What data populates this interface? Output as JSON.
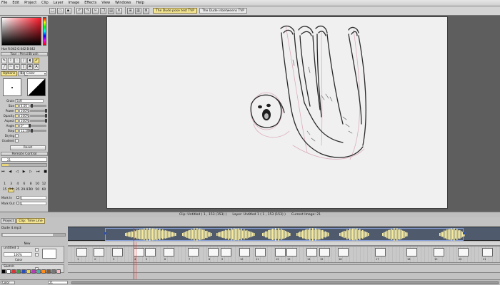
{
  "menu": [
    "File",
    "Edit",
    "Project",
    "Clip",
    "Layer",
    "Image",
    "Effects",
    "View",
    "Windows",
    "Help"
  ],
  "tabs": [
    {
      "label": "The Dude pose test TVP",
      "active": true
    },
    {
      "label": "The Dude inbetweens TVP",
      "active": false
    }
  ],
  "color_panel": {
    "readout": "Hue R:042 G:042 B:042"
  },
  "tool_panel": {
    "title": "Tool : PencilBrush",
    "mode": "Color",
    "subtabs": [
      "Options",
      "Bin"
    ],
    "params": [
      {
        "label": "Grain",
        "value": "Soft",
        "type": "dropdown"
      },
      {
        "label": "Size",
        "value": "4.00",
        "knob": 0.15
      },
      {
        "label": "Power",
        "value": "100%",
        "knob": 1.0
      },
      {
        "label": "Opacity",
        "value": "100%",
        "knob": 1.0
      },
      {
        "label": "Aspect",
        "value": "100%",
        "knob": 1.0
      },
      {
        "label": "Angle",
        "value": "0°",
        "knob": 0.0
      },
      {
        "label": "Step",
        "value": "12.50%",
        "knob": 0.12
      },
      {
        "label": "Drying",
        "value": "",
        "knob": null
      },
      {
        "label": "Gradient",
        "value": "",
        "knob": null
      }
    ],
    "reset_label": "Reset"
  },
  "remote_control": {
    "title": "Remote Control",
    "frame": "21",
    "progress": 0.14,
    "fps_row1": [
      "1",
      "3",
      "4",
      "6",
      "8",
      "10",
      "12"
    ],
    "fps_row2": [
      "15",
      "24",
      "25",
      "29.97",
      "30",
      "50",
      "60"
    ],
    "fps_selected": "24",
    "mark_in_label": "Mark In",
    "mark_in": "1",
    "mark_out_label": "Mark Out",
    "mark_out": "1"
  },
  "status": {
    "clip": "Clip: Untitled ( 1 , 153 (153) )",
    "layer": "Layer: Untitled 1 ( 1 , 153 (153) )",
    "image": "Current Image: 21"
  },
  "timeline": {
    "tabs": [
      "Project",
      "Clip: Time Line"
    ],
    "active_tab": "Clip: Time Line",
    "sound_name": "Dude 4.mp3",
    "new_label": "New",
    "layer_name": "untitled 1",
    "layer_opacity": "100%",
    "layer_color_label": "Color",
    "sketch_layer": "Sketch",
    "sketch_opacity": "15%",
    "frame_numbers": [
      "1",
      "2",
      "3",
      "4",
      "5",
      "6",
      "7",
      "8",
      "9",
      "10",
      "11",
      "12",
      "13",
      "14",
      "15",
      "16",
      "17",
      "18",
      "19",
      "20",
      "21"
    ],
    "bottom_dropdown": "Color",
    "current_frame": "21"
  },
  "colors": {
    "accent": "#f4e58f",
    "waveform": "#f3e8a2",
    "playhead": "#d23a3a"
  }
}
